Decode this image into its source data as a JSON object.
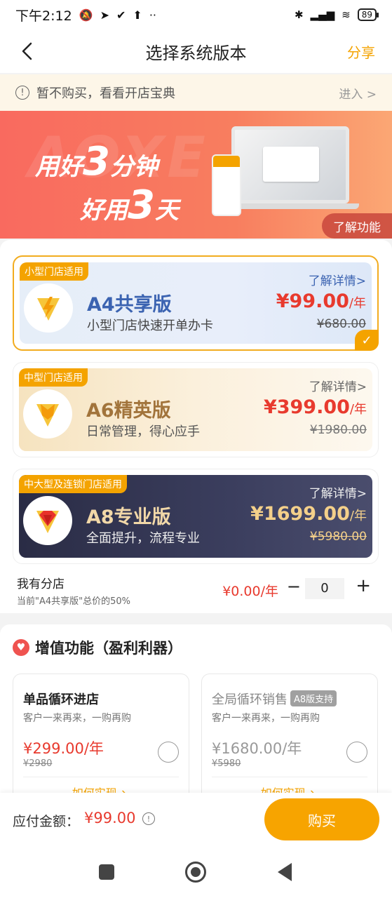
{
  "status_bar": {
    "time": "下午2:12",
    "battery": "89"
  },
  "nav": {
    "title": "选择系统版本",
    "share": "分享"
  },
  "tip": {
    "text": "暂不购买，看看开店宝典",
    "enter": "进入 >"
  },
  "banner": {
    "bg_text": "AOXE",
    "line1_pre": "用好",
    "line1_num": "3",
    "line1_post": "分钟",
    "line2_pre": "好用",
    "line2_num": "3",
    "line2_post": "天",
    "learn": "了解功能"
  },
  "plans": [
    {
      "tag": "小型门店适用",
      "name": "A4共享版",
      "desc": "小型门店快速开单办卡",
      "detail": "了解详情>",
      "price": "¥99.00",
      "unit": "/年",
      "original": "¥680.00",
      "selected": true
    },
    {
      "tag": "中型门店适用",
      "name": "A6精英版",
      "desc": "日常管理，得心应手",
      "detail": "了解详情>",
      "price": "¥399.00",
      "unit": "/年",
      "original": "¥1980.00",
      "selected": false
    },
    {
      "tag": "中大型及连锁门店适用",
      "name": "A8专业版",
      "desc": "全面提升，流程专业",
      "detail": "了解详情>",
      "price": "¥1699.00",
      "unit": "/年",
      "original": "¥5980.00",
      "selected": false
    }
  ],
  "branch": {
    "title": "我有分店",
    "sub": "当前\"A4共享版\"总价的50%",
    "price": "¥0.00/年",
    "minus": "−",
    "qty": "0",
    "plus": "+"
  },
  "value_added": {
    "heading": "增值功能（盈利利器）",
    "cards": [
      {
        "title": "单品循环进店",
        "badge": "",
        "sub": "客户一来再来，一购再购",
        "price": "¥299.00/年",
        "original": "¥2980",
        "how": "如何实现 ↘"
      },
      {
        "title": "全局循环销售",
        "badge": "A8版支持",
        "sub": "客户一来再来，一购再购",
        "price": "¥1680.00/年",
        "original": "¥5980",
        "how": "如何实现 ↘"
      }
    ]
  },
  "pay": {
    "label": "应付金额：",
    "amount": "¥99.00",
    "buy": "购买"
  },
  "colors": {
    "accent": "#f4a300",
    "price_red": "#e83a2e",
    "banner": "#f96a5f"
  }
}
